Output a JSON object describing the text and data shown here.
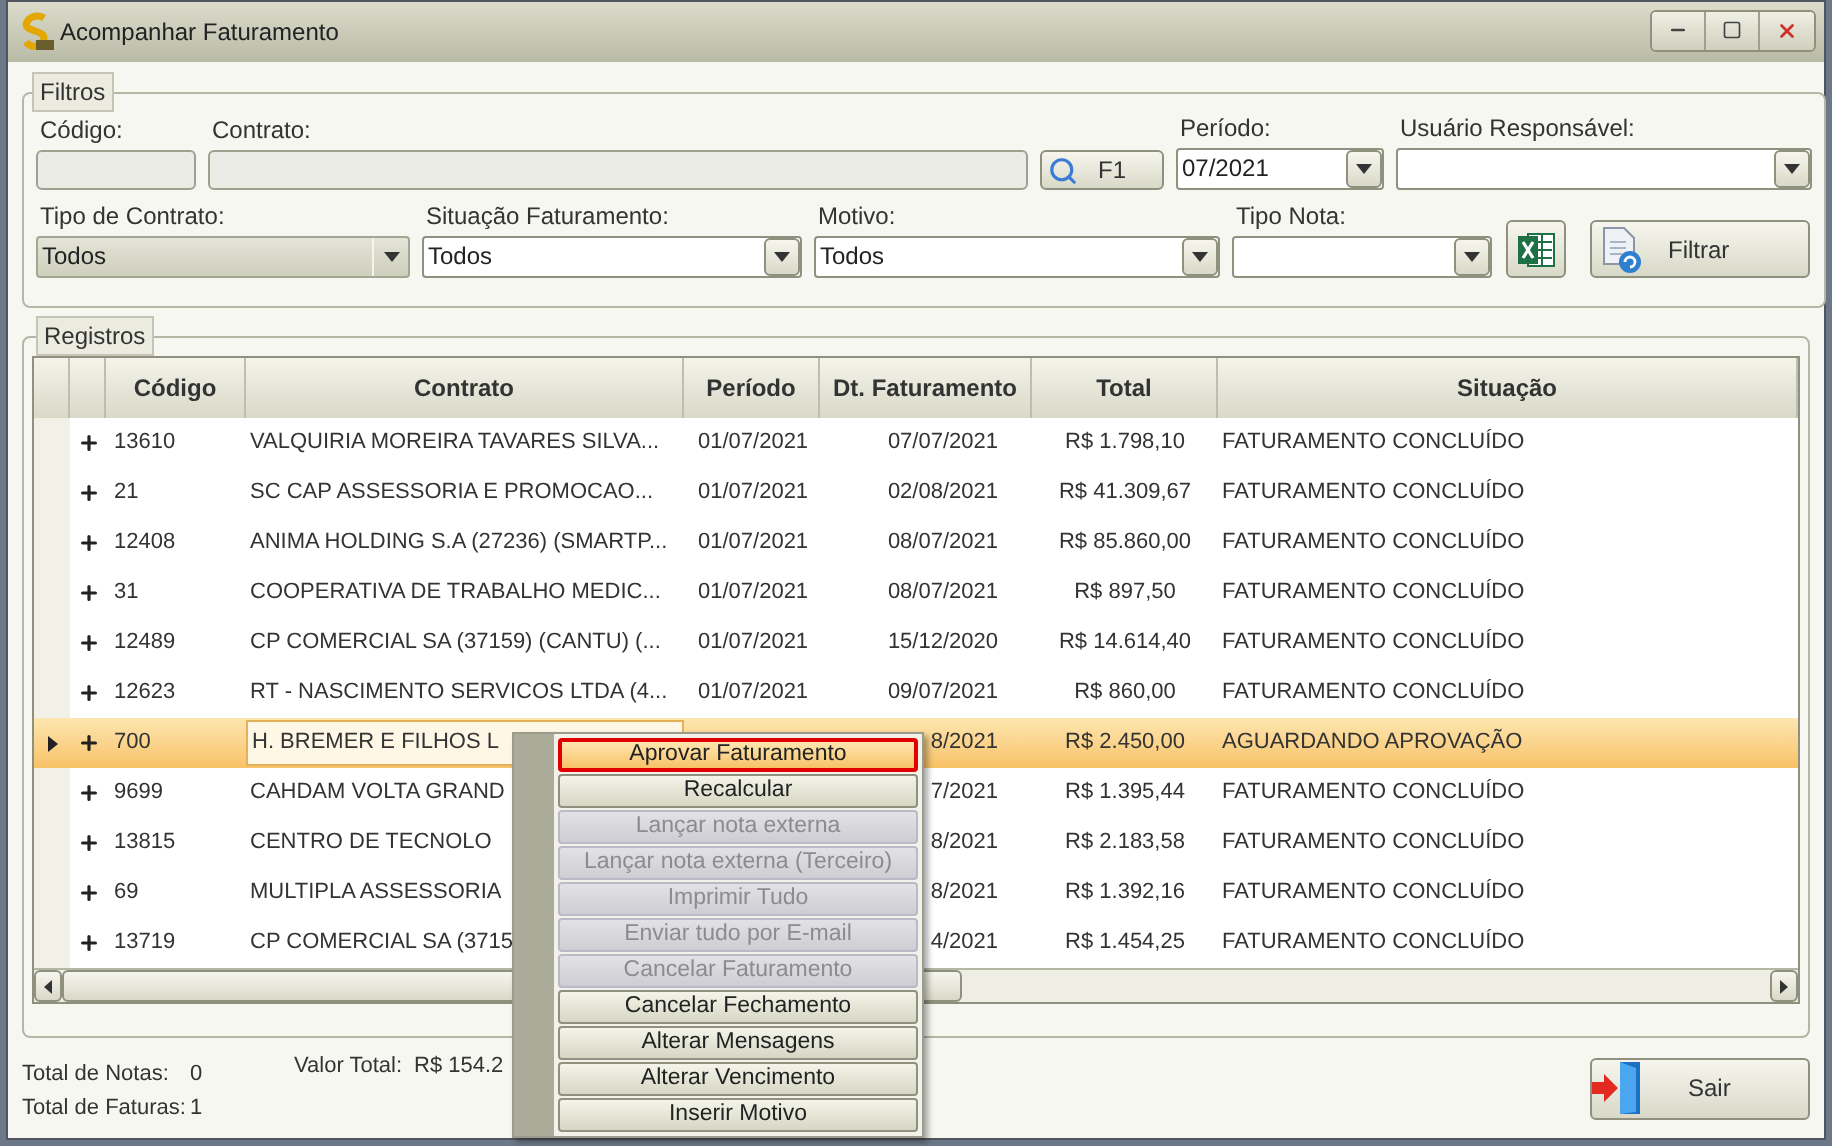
{
  "window": {
    "title": "Acompanhar Faturamento"
  },
  "filters": {
    "legend": "Filtros",
    "row1": [
      {
        "kind": "text",
        "label": "Código:",
        "disabled": true
      },
      {
        "kind": "text",
        "label": "Contrato:",
        "disabled": true
      },
      {
        "kind": "lookup",
        "label": "F1"
      },
      {
        "kind": "combo",
        "label": "Período:",
        "value": "07/2021",
        "disabled": false
      },
      {
        "kind": "combo",
        "label": "Usuário Responsável:",
        "disabled": false
      }
    ],
    "row2": [
      {
        "kind": "combo",
        "label": "Tipo de Contrato:",
        "value": "Todos",
        "disabled": true
      },
      {
        "kind": "combo",
        "label": "Situação Faturamento:",
        "value": "Todos",
        "disabled": false
      },
      {
        "kind": "combo",
        "label": "Motivo:",
        "value": "Todos",
        "disabled": false
      },
      {
        "kind": "combo",
        "label": "Tipo Nota:",
        "disabled": false
      },
      {
        "kind": "excel"
      },
      {
        "kind": "filter",
        "label": "Filtrar"
      }
    ]
  },
  "records": {
    "legend": "Registros",
    "columns": [
      "Código",
      "Contrato",
      "Período",
      "Dt. Faturamento",
      "Total",
      "Situação"
    ],
    "rows": [
      {
        "codigo": "13610",
        "contrato": "VALQUIRIA MOREIRA TAVARES SILVA...",
        "periodo": "01/07/2021",
        "dt": "07/07/2021",
        "total": "R$ 1.798,10",
        "situacao": "FATURAMENTO CONCLUÍDO",
        "selected": false
      },
      {
        "codigo": "21",
        "contrato": "SC CAP ASSESSORIA E PROMOCAO...",
        "periodo": "01/07/2021",
        "dt": "02/08/2021",
        "total": "R$ 41.309,67",
        "situacao": "FATURAMENTO CONCLUÍDO",
        "selected": false
      },
      {
        "codigo": "12408",
        "contrato": "ANIMA HOLDING S.A (27236) (SMARTP...",
        "periodo": "01/07/2021",
        "dt": "08/07/2021",
        "total": "R$ 85.860,00",
        "situacao": "FATURAMENTO CONCLUÍDO",
        "selected": false
      },
      {
        "codigo": "31",
        "contrato": "COOPERATIVA DE TRABALHO MEDIC...",
        "periodo": "01/07/2021",
        "dt": "08/07/2021",
        "total": "R$ 897,50",
        "situacao": "FATURAMENTO CONCLUÍDO",
        "selected": false
      },
      {
        "codigo": "12489",
        "contrato": "CP COMERCIAL SA (37159) (CANTU) (...",
        "periodo": "01/07/2021",
        "dt": "15/12/2020",
        "total": "R$ 14.614,40",
        "situacao": "FATURAMENTO CONCLUÍDO",
        "selected": false
      },
      {
        "codigo": "12623",
        "contrato": "RT - NASCIMENTO SERVICOS LTDA (4...",
        "periodo": "01/07/2021",
        "dt": "09/07/2021",
        "total": "R$ 860,00",
        "situacao": "FATURAMENTO CONCLUÍDO",
        "selected": false
      },
      {
        "codigo": "700",
        "contrato": "H. BREMER E FILHOS L",
        "dt": "8/2021",
        "total": "R$ 2.450,00",
        "situacao": "AGUARDANDO APROVAÇÃO",
        "selected": true
      },
      {
        "codigo": "9699",
        "contrato": "CAHDAM VOLTA GRAND",
        "dt": "7/2021",
        "total": "R$ 1.395,44",
        "situacao": "FATURAMENTO CONCLUÍDO",
        "selected": false
      },
      {
        "codigo": "13815",
        "contrato": "CENTRO DE TECNOLO",
        "dt": "8/2021",
        "total": "R$ 2.183,58",
        "situacao": "FATURAMENTO CONCLUÍDO",
        "selected": false
      },
      {
        "codigo": "69",
        "contrato": "MULTIPLA ASSESSORIA",
        "dt": "8/2021",
        "total": "R$ 1.392,16",
        "situacao": "FATURAMENTO CONCLUÍDO",
        "selected": false
      },
      {
        "codigo": "13719",
        "contrato": "CP COMERCIAL SA (3715",
        "dt": "4/2021",
        "total": "R$ 1.454,25",
        "situacao": "FATURAMENTO CONCLUÍDO",
        "selected": false
      }
    ]
  },
  "footer": {
    "total_notas_label": "Total de Notas:",
    "total_notas": "0",
    "valor_total_label": "Valor Total:",
    "valor_total": "R$ 154.2",
    "total_faturas_label": "Total de Faturas:",
    "total_faturas": "1",
    "exit_button": "Sair"
  },
  "context_menu": [
    {
      "label": "Aprovar Faturamento",
      "disabled": false,
      "selected": true
    },
    {
      "label": "Recalcular",
      "disabled": false,
      "selected": false
    },
    {
      "label": "Lançar nota externa",
      "disabled": true,
      "selected": false
    },
    {
      "label": "Lançar nota externa (Terceiro)",
      "disabled": true,
      "selected": false
    },
    {
      "label": "Imprimir Tudo",
      "disabled": true,
      "selected": false
    },
    {
      "label": "Enviar tudo por E-mail",
      "disabled": true,
      "selected": false
    },
    {
      "label": "Cancelar Faturamento",
      "disabled": true,
      "selected": false
    },
    {
      "label": "Cancelar Fechamento",
      "disabled": false,
      "selected": false
    },
    {
      "label": "Alterar Mensagens",
      "disabled": false,
      "selected": false
    },
    {
      "label": "Alterar Vencimento",
      "disabled": false,
      "selected": false
    },
    {
      "label": "Inserir Motivo",
      "disabled": false,
      "selected": false
    }
  ]
}
